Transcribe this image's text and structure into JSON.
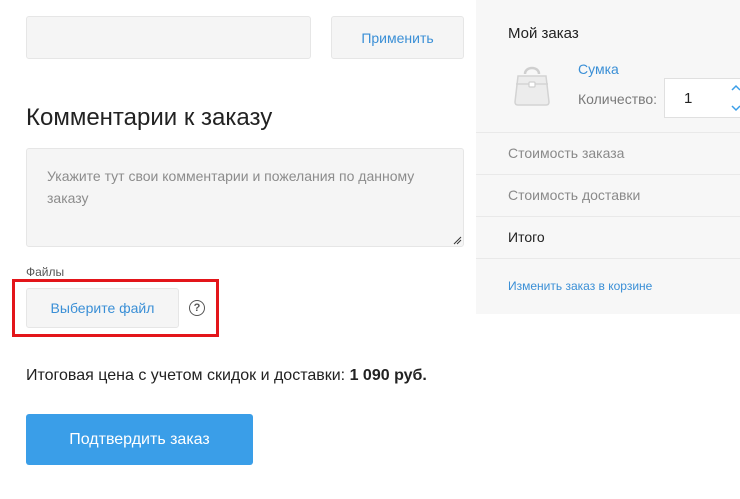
{
  "promo": {
    "input_value": "",
    "apply_label": "Применить"
  },
  "comments": {
    "title": "Комментарии к заказу",
    "placeholder": "Укажите тут свои комментарии и пожелания по данному заказу"
  },
  "files": {
    "label": "Файлы",
    "choose_label": "Выберите файл",
    "help_glyph": "?"
  },
  "total": {
    "text": "Итоговая цена с учетом скидок и доставки:",
    "amount": "1 090 руб."
  },
  "confirm_label": "Подтвердить заказ",
  "sidebar": {
    "title": "Мой заказ",
    "product_name": "Сумка",
    "quantity_label": "Количество:",
    "quantity_value": "1",
    "order_cost_label": "Стоимость заказа",
    "delivery_cost_label": "Стоимость доставки",
    "total_label": "Итого",
    "change_link": "Изменить заказ в корзине"
  },
  "colors": {
    "accent": "#3a9ee8",
    "link": "#3a8fd6",
    "highlight": "#e3151a",
    "field_bg": "#f5f5f5",
    "sidebar_bg": "#f7f7f7"
  },
  "icons": {
    "product": "bag-icon",
    "help": "question-circle-icon",
    "resize": "resize-grip-icon",
    "spinner": "chevron-updown-icon"
  }
}
